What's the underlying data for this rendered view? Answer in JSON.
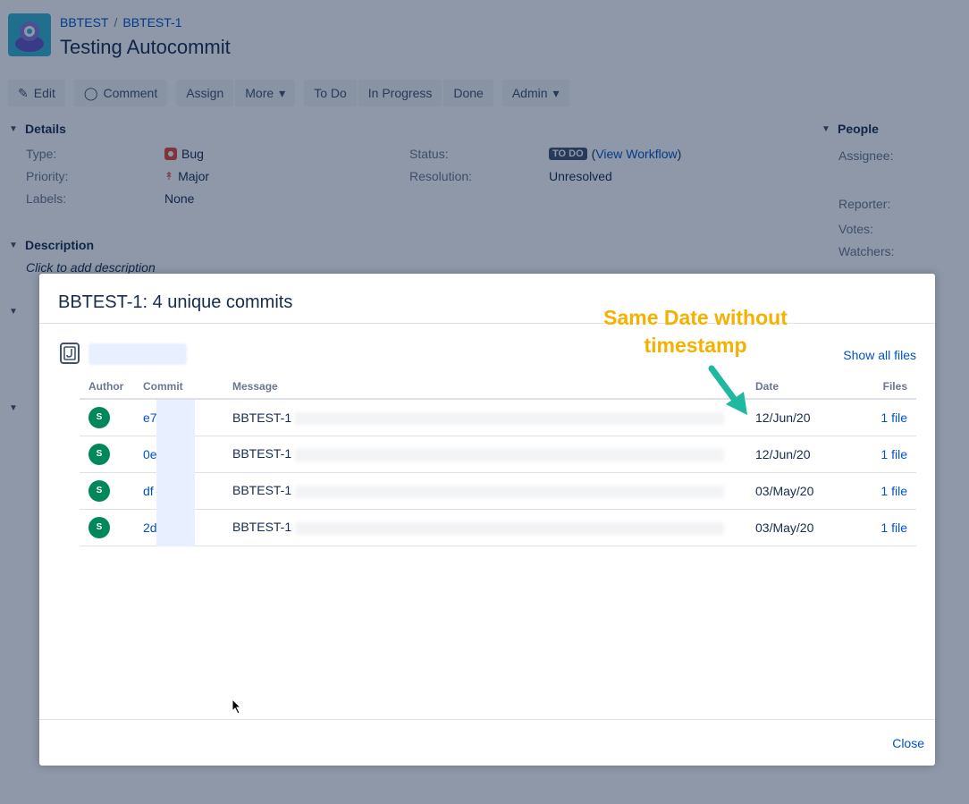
{
  "header": {
    "project": "BBTEST",
    "issue_key": "BBTEST-1",
    "title": "Testing Autocommit"
  },
  "toolbar": {
    "edit": "Edit",
    "comment": "Comment",
    "assign": "Assign",
    "more": "More",
    "todo": "To Do",
    "in_progress": "In Progress",
    "done": "Done",
    "admin": "Admin"
  },
  "details": {
    "heading": "Details",
    "type_label": "Type:",
    "type_value": "Bug",
    "priority_label": "Priority:",
    "priority_value": "Major",
    "labels_label": "Labels:",
    "labels_value": "None",
    "status_label": "Status:",
    "status_value": "TO DO",
    "view_workflow": "View Workflow",
    "resolution_label": "Resolution:",
    "resolution_value": "Unresolved"
  },
  "description": {
    "heading": "Description",
    "placeholder": "Click to add description"
  },
  "people": {
    "heading": "People",
    "assignee_label": "Assignee:",
    "reporter_label": "Reporter:",
    "votes_label": "Votes:",
    "watchers_label": "Watchers:"
  },
  "dialog": {
    "title": "BBTEST-1: 4 unique commits",
    "show_all_files": "Show all files",
    "close": "Close",
    "columns": [
      "Author",
      "Commit",
      "Message",
      "Date",
      "Files"
    ],
    "commits": [
      {
        "author_initial": "S",
        "hash": "e7",
        "message": "BBTEST-1",
        "date": "12/Jun/20",
        "files": "1 file"
      },
      {
        "author_initial": "S",
        "hash": "0e",
        "message": "BBTEST-1",
        "date": "12/Jun/20",
        "files": "1 file"
      },
      {
        "author_initial": "S",
        "hash": "df",
        "message": "BBTEST-1",
        "date": "03/May/20",
        "files": "1 file"
      },
      {
        "author_initial": "S",
        "hash": "2d",
        "message": "BBTEST-1",
        "date": "03/May/20",
        "files": "1 file"
      }
    ]
  },
  "annotation": {
    "line1": "Same Date without",
    "line2": "timestamp",
    "color": "#f5b100",
    "arrow_color": "#1fb8a0"
  }
}
